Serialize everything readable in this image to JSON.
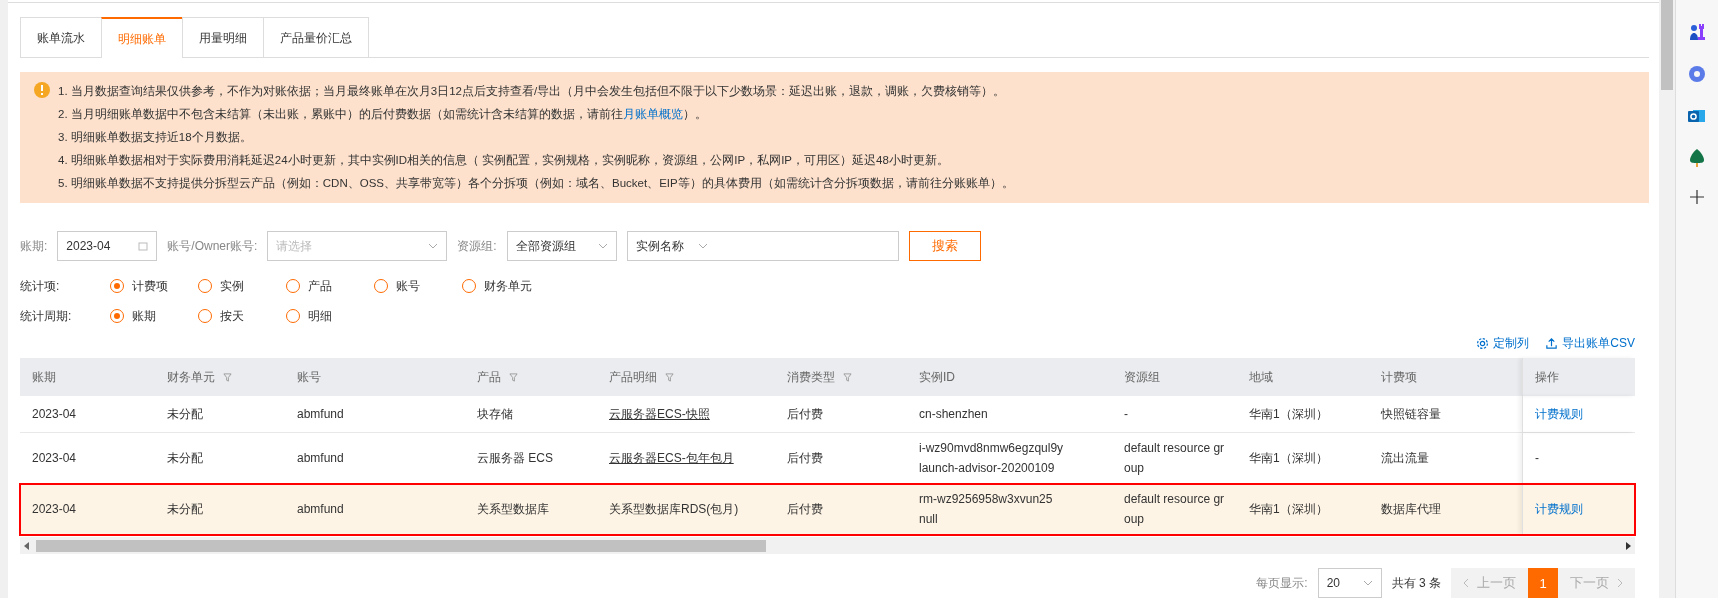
{
  "tabs": [
    {
      "label": "账单流水",
      "selected": false
    },
    {
      "label": "明细账单",
      "selected": true
    },
    {
      "label": "用量明细",
      "selected": false
    },
    {
      "label": "产品量价汇总",
      "selected": false
    }
  ],
  "notice": {
    "lines": [
      {
        "text": "1. 当月数据查询结果仅供参考，不作为对账依据；当月最终账单在次月3日12点后支持查看/导出（月中会发生包括但不限于以下少数场景：延迟出账，退款，调账，欠费核销等）。"
      },
      {
        "text": "2. 当月明细账单数据中不包含未结算（未出账，累账中）的后付费数据（如需统计含未结算的数据，请前往",
        "link": "月账单概览",
        "after": "）。"
      },
      {
        "text": "3. 明细账单数据支持近18个月数据。"
      },
      {
        "text": "4. 明细账单数据相对于实际费用消耗延迟24小时更新，其中实例ID相关的信息（ 实例配置，实例规格，实例昵称，资源组，公网IP，私网IP，可用区）延迟48小时更新。"
      },
      {
        "text": "5. 明细账单数据不支持提供分拆型云产品（例如：CDN、OSS、共享带宽等）各个分拆项（例如：域名、Bucket、EIP等）的具体费用（如需统计含分拆项数据，请前往分账账单）。"
      }
    ]
  },
  "filters": {
    "period_label": "账期:",
    "period_value": "2023-04",
    "account_label": "账号/Owner账号:",
    "account_placeholder": "请选择",
    "group_label": "资源组:",
    "group_value": "全部资源组",
    "instance_value": "实例名称",
    "search_button": "搜索"
  },
  "radio_groups": [
    {
      "label": "统计项:",
      "options": [
        {
          "label": "计费项",
          "selected": true
        },
        {
          "label": "实例",
          "selected": false
        },
        {
          "label": "产品",
          "selected": false
        },
        {
          "label": "账号",
          "selected": false
        },
        {
          "label": "财务单元",
          "selected": false
        }
      ]
    },
    {
      "label": "统计周期:",
      "options": [
        {
          "label": "账期",
          "selected": true
        },
        {
          "label": "按天",
          "selected": false
        },
        {
          "label": "明细",
          "selected": false
        }
      ]
    }
  ],
  "toolbar": {
    "customize": "定制列",
    "export": "导出账单CSV"
  },
  "table": {
    "columns": [
      {
        "label": "账期",
        "filter": false
      },
      {
        "label": "财务单元",
        "filter": true
      },
      {
        "label": "账号",
        "filter": false
      },
      {
        "label": "产品",
        "filter": true
      },
      {
        "label": "产品明细",
        "filter": true
      },
      {
        "label": "消费类型",
        "filter": true
      },
      {
        "label": "实例ID",
        "filter": false
      },
      {
        "label": "资源组",
        "filter": false
      },
      {
        "label": "地域",
        "filter": false
      },
      {
        "label": "计费项",
        "filter": false
      },
      {
        "label": "操作",
        "filter": false
      }
    ],
    "rows": [
      {
        "highlighted": false,
        "cells": [
          {
            "kind": "text",
            "lines": [
              "2023-04"
            ]
          },
          {
            "kind": "text",
            "lines": [
              "未分配"
            ]
          },
          {
            "kind": "text",
            "lines": [
              "abmfund"
            ]
          },
          {
            "kind": "text",
            "lines": [
              "块存储"
            ]
          },
          {
            "kind": "underlined",
            "lines": [
              "云服务器ECS-快照"
            ]
          },
          {
            "kind": "text",
            "lines": [
              "后付费"
            ]
          },
          {
            "kind": "text",
            "lines": [
              "cn-shenzhen"
            ]
          },
          {
            "kind": "text",
            "lines": [
              "-"
            ]
          },
          {
            "kind": "text",
            "lines": [
              "华南1（深圳）"
            ]
          },
          {
            "kind": "text",
            "lines": [
              "快照链容量"
            ]
          },
          {
            "kind": "link",
            "lines": [
              "计费规则"
            ]
          }
        ]
      },
      {
        "highlighted": false,
        "cells": [
          {
            "kind": "text",
            "lines": [
              "2023-04"
            ]
          },
          {
            "kind": "text",
            "lines": [
              "未分配"
            ]
          },
          {
            "kind": "text",
            "lines": [
              "abmfund"
            ]
          },
          {
            "kind": "text",
            "lines": [
              "云服务器 ECS"
            ]
          },
          {
            "kind": "underlined",
            "lines": [
              "云服务器ECS-包年包月"
            ]
          },
          {
            "kind": "text",
            "lines": [
              "后付费"
            ]
          },
          {
            "kind": "text",
            "lines": [
              "i-wz90mvd8nmw6egzqul9y",
              "launch-advisor-20200109"
            ]
          },
          {
            "kind": "text",
            "lines": [
              "default resource group"
            ]
          },
          {
            "kind": "text",
            "lines": [
              "华南1（深圳）"
            ]
          },
          {
            "kind": "text",
            "lines": [
              "流出流量"
            ]
          },
          {
            "kind": "text",
            "lines": [
              "-"
            ]
          }
        ]
      },
      {
        "highlighted": true,
        "cells": [
          {
            "kind": "text",
            "lines": [
              "2023-04"
            ]
          },
          {
            "kind": "text",
            "lines": [
              "未分配"
            ]
          },
          {
            "kind": "text",
            "lines": [
              "abmfund"
            ]
          },
          {
            "kind": "text",
            "lines": [
              "关系型数据库"
            ]
          },
          {
            "kind": "text",
            "lines": [
              "关系型数据库RDS(包月)"
            ]
          },
          {
            "kind": "text",
            "lines": [
              "后付费"
            ]
          },
          {
            "kind": "text",
            "lines": [
              "rm-wz9256958w3xvun25",
              "null"
            ]
          },
          {
            "kind": "text",
            "lines": [
              "default resource group"
            ]
          },
          {
            "kind": "text",
            "lines": [
              "华南1（深圳）"
            ]
          },
          {
            "kind": "text",
            "lines": [
              "数据库代理"
            ]
          },
          {
            "kind": "link",
            "lines": [
              "计费规则"
            ]
          }
        ]
      }
    ]
  },
  "pagination": {
    "per_page_label": "每页显示:",
    "per_page": "20",
    "total": "共有 3 条",
    "prev": "上一页",
    "next": "下一页",
    "pages": [
      {
        "label": "1",
        "selected": true
      }
    ]
  }
}
